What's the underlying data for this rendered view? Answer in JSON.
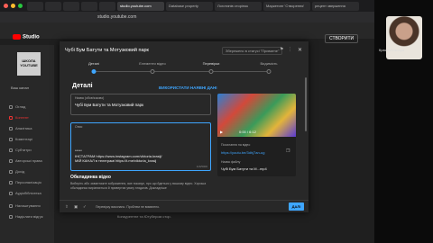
{
  "browser": {
    "tabs": [
      "",
      "",
      "",
      "",
      "",
      "studio.youtube.com",
      "Database property",
      "Логотипів сторінок",
      "Маркетинг 'Створення'",
      "рецепт зверження"
    ],
    "url": "studio.youtube.com"
  },
  "participant": {
    "name": "Краснобокоэра"
  },
  "studio": {
    "logo": "Studio",
    "create": "СТВОРИТИ",
    "channel_avatar": "ШКОЛА YOUTUBE",
    "channel_label": "Ваш канал",
    "nav": [
      "Огляд",
      "Контент",
      "Аналітика",
      "Коментарі",
      "Субтитри",
      "Авторські права",
      "Дохід",
      "Персоналізація",
      "Аудіобібліотека",
      "Налаштування",
      "Надіслати відгук"
    ],
    "bg_row": "Конкурентне та Ютубером стор."
  },
  "modal": {
    "title": "Чубі Бум Батути та Мотузковий парк",
    "saved": "Збережено в статусі \"Приватне\"",
    "close": "✕",
    "steps": [
      "Деталі",
      "Елементи відео",
      "Перевірки",
      "Видимість"
    ],
    "section": "Деталі",
    "auto_link": "ВИКОРИСТАТИ НАЯВНІ ДАНІ",
    "title_field": {
      "label": "Назва (обов'язково)",
      "value": "Чубі Бум Батути та Мотузковий парк"
    },
    "desc_field": {
      "label": "Опис",
      "lines": [
        "*****",
        "ІНСТАГРАМ https://www.instagram.com/viktoria.krasij/",
        "МІЙ КАНАЛ в телеграмі https://t.me/viktoria_krasij"
      ],
      "counter": "116/5000"
    },
    "thumb_label": "Обкладинка відео",
    "thumb_help": "Виберіть або завантажте зображення, яке показує, про що йдеться у вашому відео. Хороша обкладинка вирізняється й привертає увагу глядачів. Докладніше",
    "preview": {
      "time": "0:00 / 6:12",
      "link_label": "Посилання на відео",
      "link": "https://youtu.be/3dhj7an-ug",
      "file_label": "Назва файлу",
      "file": "Чубі Бум Батути та М...mp4"
    },
    "footer_status": "Перевірку виконано. Проблем не виявлено.",
    "next": "ДАЛІ"
  }
}
